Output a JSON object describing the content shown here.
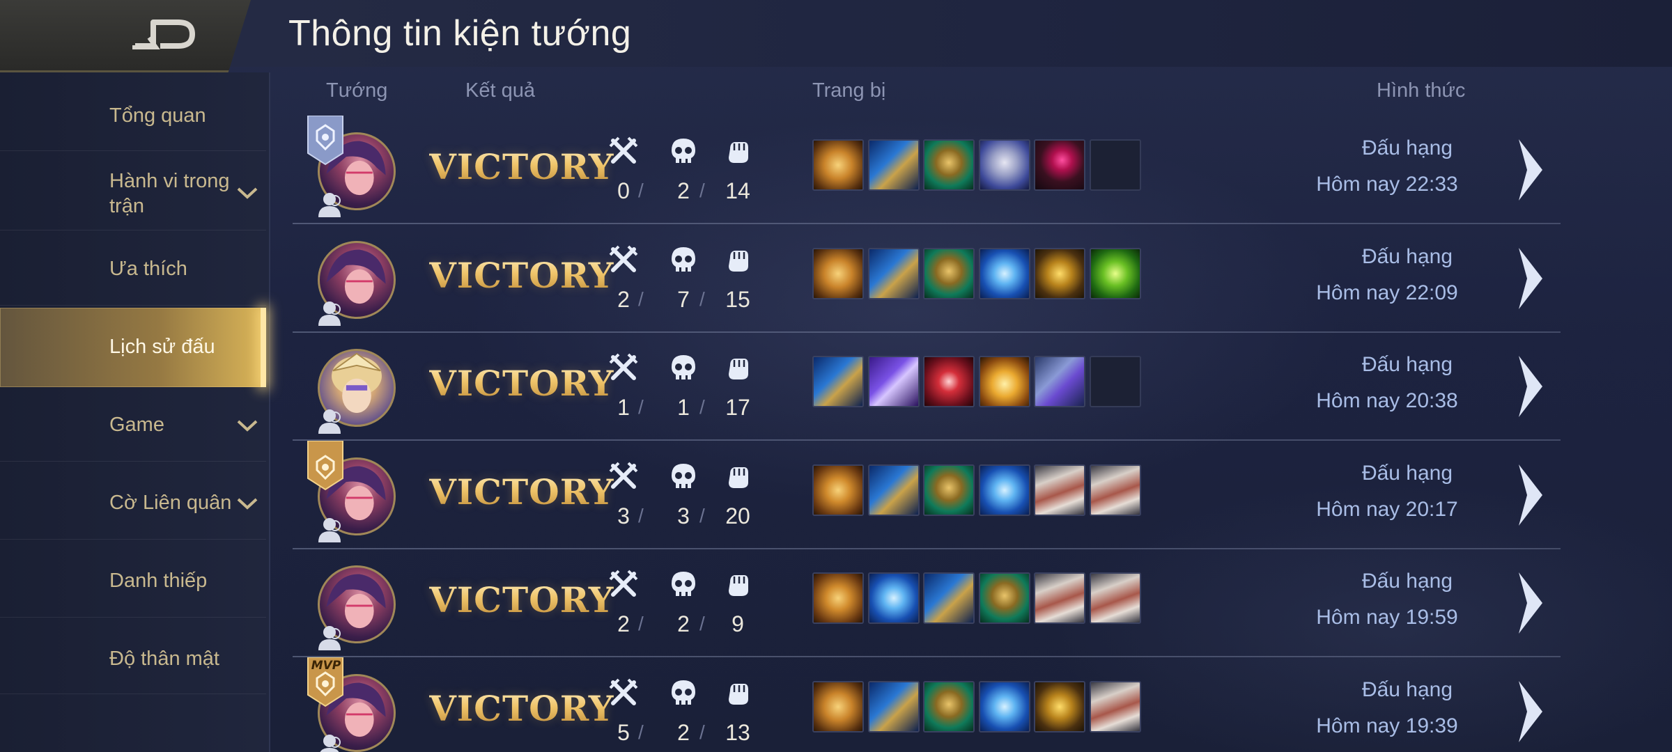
{
  "header": {
    "title": "Thông tin kiện tướng"
  },
  "sidebar": {
    "items": [
      {
        "label": "Tổng quan",
        "chevron": false,
        "active": false
      },
      {
        "label": "Hành vi trong trận",
        "chevron": true,
        "active": false
      },
      {
        "label": "Ưa thích",
        "chevron": false,
        "active": false
      },
      {
        "label": "Lịch sử đấu",
        "chevron": false,
        "active": true
      },
      {
        "label": "Game",
        "chevron": true,
        "active": false
      },
      {
        "label": "Cờ Liên quân",
        "chevron": true,
        "active": false
      },
      {
        "label": "Danh thiếp",
        "chevron": false,
        "active": false
      },
      {
        "label": "Độ thân mật",
        "chevron": false,
        "active": false
      }
    ]
  },
  "table": {
    "headers": {
      "hero": "Tướng",
      "result": "Kết quả",
      "items": "Trang bị",
      "mode": "Hình thức"
    },
    "rows": [
      {
        "hero": "hero-portrait-pink",
        "badge": "silver",
        "result": "VICTORY",
        "kills": "0",
        "deaths": "2",
        "assists": "14",
        "items": [
          "gold-rune-shield",
          "blue-boots",
          "green-gauntlet",
          "silver-armor",
          "ruby-ring",
          "empty"
        ],
        "mode": "Đấu hạng",
        "time": "Hôm nay 22:33"
      },
      {
        "hero": "hero-portrait-pink",
        "badge": "",
        "result": "VICTORY",
        "kills": "2",
        "deaths": "7",
        "assists": "15",
        "items": [
          "gold-rune-shield",
          "blue-boots",
          "green-gauntlet",
          "frost-orb",
          "gold-chest-armor",
          "green-bow"
        ],
        "mode": "Đấu hạng",
        "time": "Hôm nay 22:09"
      },
      {
        "hero": "hero-portrait-gold",
        "badge": "",
        "result": "VICTORY",
        "kills": "1",
        "deaths": "1",
        "assists": "17",
        "items": [
          "blue-boots",
          "purple-tome",
          "crimson-wand",
          "gold-crown",
          "crystal-book",
          "empty"
        ],
        "mode": "Đấu hạng",
        "time": "Hôm nay 20:38"
      },
      {
        "hero": "hero-portrait-pink",
        "badge": "gold",
        "result": "VICTORY",
        "kills": "3",
        "deaths": "3",
        "assists": "20",
        "items": [
          "gold-eye-shield",
          "blue-boots",
          "green-gauntlet",
          "frost-orb",
          "scroll-box",
          "scroll-box"
        ],
        "mode": "Đấu hạng",
        "time": "Hôm nay 20:17"
      },
      {
        "hero": "hero-portrait-pink",
        "badge": "",
        "result": "VICTORY",
        "kills": "2",
        "deaths": "2",
        "assists": "9",
        "items": [
          "gold-eye-shield",
          "frost-orb",
          "blue-boots",
          "green-gauntlet",
          "scroll-box",
          "scroll-box"
        ],
        "mode": "Đấu hạng",
        "time": "Hôm nay 19:59"
      },
      {
        "hero": "hero-portrait-pink",
        "badge": "mvp",
        "badge_text": "MVP",
        "result": "VICTORY",
        "kills": "5",
        "deaths": "2",
        "assists": "13",
        "items": [
          "gold-rune-shield",
          "blue-boots",
          "green-gauntlet",
          "frost-orb",
          "gold-chest-armor",
          "scroll-box"
        ],
        "mode": "Đấu hạng",
        "time": "Hôm nay 19:39"
      }
    ]
  },
  "colors": {
    "accent_gold": "#f0c66e",
    "text_blue": "#a9bde6",
    "sidebar_text": "#c9b98f"
  }
}
